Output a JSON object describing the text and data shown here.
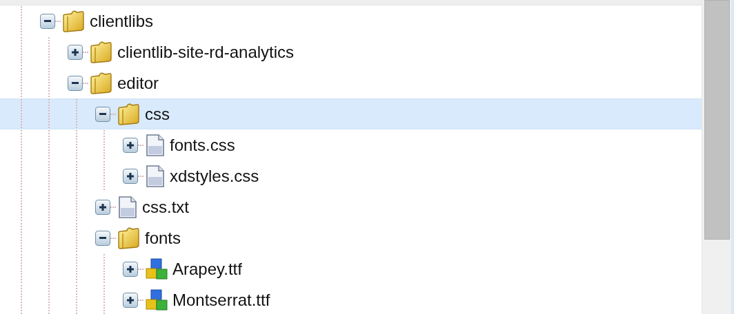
{
  "tree": {
    "items": [
      {
        "label": "clientlibs",
        "kind": "folder",
        "expanded": true,
        "selected": false,
        "children": [
          {
            "label": "clientlib-site-rd-analytics",
            "kind": "folder",
            "expanded": false,
            "selected": false
          },
          {
            "label": "editor",
            "kind": "folder",
            "expanded": true,
            "selected": false,
            "children": [
              {
                "label": "css",
                "kind": "folder",
                "expanded": true,
                "selected": true,
                "children": [
                  {
                    "label": "fonts.css",
                    "kind": "file",
                    "expanded": false,
                    "selected": false
                  },
                  {
                    "label": "xdstyles.css",
                    "kind": "file",
                    "expanded": false,
                    "selected": false
                  }
                ]
              },
              {
                "label": "css.txt",
                "kind": "file",
                "expanded": false,
                "selected": false
              },
              {
                "label": "fonts",
                "kind": "folder",
                "expanded": true,
                "selected": false,
                "children": [
                  {
                    "label": "Arapey.ttf",
                    "kind": "package",
                    "expanded": false,
                    "selected": false
                  },
                  {
                    "label": "Montserrat.ttf",
                    "kind": "package",
                    "expanded": false,
                    "selected": false
                  }
                ]
              }
            ]
          }
        ]
      }
    ]
  }
}
